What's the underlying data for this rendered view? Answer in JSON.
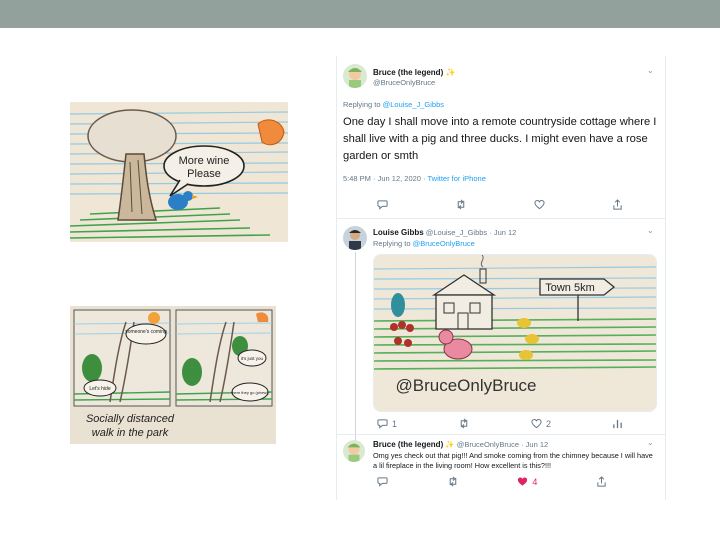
{
  "tweet1": {
    "display_name": "Bruce (the legend)",
    "sparkle": "✨",
    "handle": "@BruceOnlyBruce",
    "replying_prefix": "Replying to",
    "replying_to": "@Louise_J_Gibbs",
    "text": "One day I shall move into a remote countryside cottage where I shall live with a pig and three ducks. I might even have a rose garden or smth",
    "time": "5:48 PM · Jun 12, 2020 · ",
    "source": "Twitter for iPhone"
  },
  "tweet2": {
    "display_name": "Louise Gibbs",
    "handle_date": "@Louise_J_Gibbs · Jun 12",
    "replying_prefix": "Replying to",
    "replying_to": "@BruceOnlyBruce",
    "image_text": {
      "sign": "Town 5km",
      "credit": "@BruceOnlyBruce"
    },
    "replies": "1",
    "likes": "2"
  },
  "tweet3": {
    "display_name": "Bruce (the legend)",
    "sparkle": "✨",
    "handle_date": "@BruceOnlyBruce · Jun 12",
    "text": "Omg yes check out that pig!!! And smoke coming from the chimney because I will have a lil fireplace in the living room! How excellent is this?!!!",
    "likes": "4"
  },
  "doodle1": {
    "bubble_line1": "More wine",
    "bubble_line2": "Please"
  },
  "doodle2": {
    "bubble_a": "someone's coming",
    "bubble_b": "Let's hide",
    "bubble_c": "it's just you",
    "bubble_d": "there they go (phew!)",
    "caption_line1": "Socially distanced",
    "caption_line2": "walk in the park"
  },
  "icons": [
    "reply-icon",
    "retweet-icon",
    "heart-icon",
    "share-icon",
    "chevron-down-icon",
    "sparkle-icon"
  ],
  "colors": {
    "link": "#1da1f2",
    "heart": "#e0245e",
    "topbar": "#93a19c"
  }
}
